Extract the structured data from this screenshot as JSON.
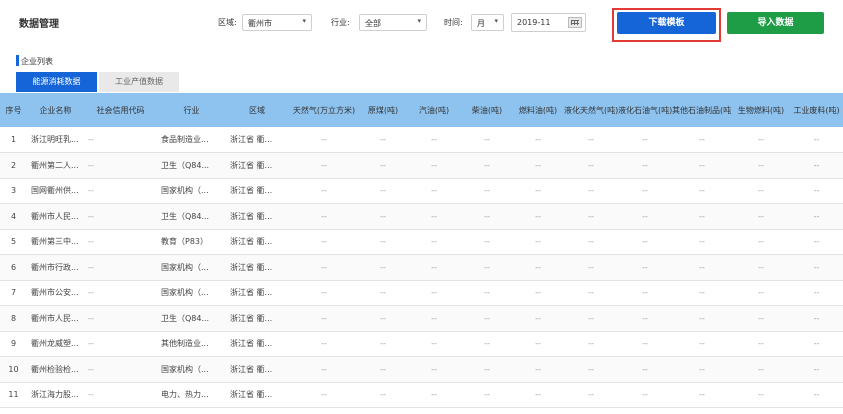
{
  "header": {
    "title": "数据管理",
    "region_label": "区域:",
    "region_value": "衢州市",
    "industry_label": "行业:",
    "industry_value": "全部",
    "time_label": "时间:",
    "time_unit": "月",
    "date_value": "2019-11",
    "download_template": "下载模板",
    "import_data": "导入数据"
  },
  "section": {
    "title": "企业列表",
    "tabs": [
      "能源消耗数据",
      "工业产值数据"
    ]
  },
  "table": {
    "columns": [
      "序号",
      "企业名称",
      "社会信用代码",
      "行业",
      "区域",
      "天然气(万立方米)",
      "原煤(吨)",
      "汽油(吨)",
      "柴油(吨)",
      "燃料油(吨)",
      "液化天然气(吨)",
      "液化石油气(吨)",
      "其他石油制品(吨)",
      "生物燃料(吨)",
      "工业废料(吨)"
    ],
    "rows": [
      {
        "no": "1",
        "name": "浙江明旺乳...",
        "code": "--",
        "industry": "食品制造业...",
        "region": "浙江省 衢..."
      },
      {
        "no": "2",
        "name": "衢州第二人...",
        "code": "--",
        "industry": "卫生（Q84...",
        "region": "浙江省 衢..."
      },
      {
        "no": "3",
        "name": "国网衢州供...",
        "code": "--",
        "industry": "国家机构（...",
        "region": "浙江省 衢..."
      },
      {
        "no": "4",
        "name": "衢州市人民...",
        "code": "--",
        "industry": "卫生（Q84...",
        "region": "浙江省 衢..."
      },
      {
        "no": "5",
        "name": "衢州第三中...",
        "code": "--",
        "industry": "教育（P83）",
        "region": "浙江省 衢..."
      },
      {
        "no": "6",
        "name": "衢州市行政...",
        "code": "--",
        "industry": "国家机构（...",
        "region": "浙江省 衢..."
      },
      {
        "no": "7",
        "name": "衢州市公安...",
        "code": "--",
        "industry": "国家机构（...",
        "region": "浙江省 衢..."
      },
      {
        "no": "8",
        "name": "衢州市人民...",
        "code": "--",
        "industry": "卫生（Q84...",
        "region": "浙江省 衢..."
      },
      {
        "no": "9",
        "name": "衢州龙威塑...",
        "code": "--",
        "industry": "其他制造业...",
        "region": "浙江省 衢..."
      },
      {
        "no": "10",
        "name": "衢州检验检...",
        "code": "--",
        "industry": "国家机构（...",
        "region": "浙江省 衢..."
      },
      {
        "no": "11",
        "name": "浙江海力股...",
        "code": "--",
        "industry": "电力、热力...",
        "region": "浙江省 衢..."
      }
    ],
    "empty_value": "--"
  },
  "colors": {
    "primary_blue": "#1565d8",
    "import_green": "#1f9c46",
    "header_row_blue": "#8ec3f0",
    "highlight_red": "#e53935"
  }
}
